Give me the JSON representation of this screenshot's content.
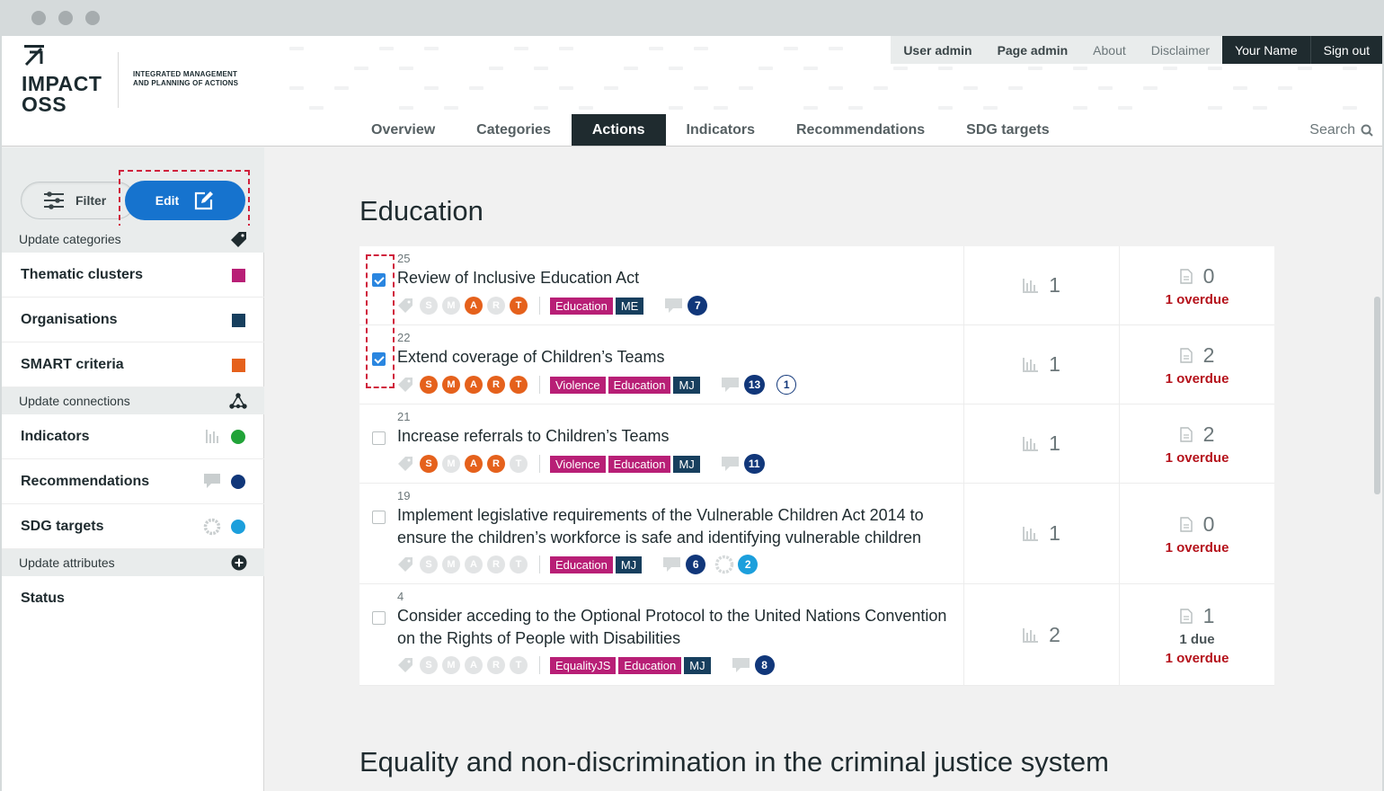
{
  "header": {
    "logo": {
      "line1": "IMPACT",
      "line2": "OSS"
    },
    "tagline_1": "INTEGRATED MANAGEMENT",
    "tagline_2": "AND PLANNING OF ACTIONS",
    "topbar": [
      "User admin",
      "Page admin",
      "About",
      "Disclaimer",
      "Your Name",
      "Sign out"
    ],
    "nav": [
      "Overview",
      "Categories",
      "Actions",
      "Indicators",
      "Recommendations",
      "SDG targets"
    ],
    "active_nav": "Actions",
    "search_label": "Search"
  },
  "sidebar": {
    "filter_label": "Filter",
    "edit_label": "Edit",
    "update_categories": "Update categories",
    "categories": [
      {
        "label": "Thematic clusters",
        "color": "#b81f76"
      },
      {
        "label": "Organisations",
        "color": "#173f5e"
      },
      {
        "label": "SMART criteria",
        "color": "#e5611c"
      }
    ],
    "update_connections": "Update connections",
    "connections": [
      {
        "label": "Indicators",
        "color": "#21a338",
        "icon": "bar-chart-icon"
      },
      {
        "label": "Recommendations",
        "color": "#11377a",
        "icon": "comment-icon"
      },
      {
        "label": "SDG targets",
        "color": "#1c9fdc",
        "icon": "sdg-ring-icon"
      }
    ],
    "update_attributes": "Update attributes",
    "attributes": [
      "Status"
    ]
  },
  "main": {
    "section_1_title": "Education",
    "section_2_title": "Equality and non-discrimination in the criminal justice system",
    "actions": [
      {
        "ref": "25",
        "title": "Review of Inclusive Education Act",
        "checked": true,
        "smart": [
          false,
          false,
          true,
          false,
          true
        ],
        "categories": [
          {
            "label": "Education",
            "color": "pink"
          },
          {
            "label": "ME",
            "color": "navy"
          }
        ],
        "recommendations": "7",
        "sdg": null,
        "extra": null,
        "indicators": "1",
        "reports": "0",
        "due": null,
        "overdue": "1 overdue"
      },
      {
        "ref": "22",
        "title": "Extend coverage of Children’s Teams",
        "checked": true,
        "smart": [
          true,
          true,
          true,
          true,
          true
        ],
        "categories": [
          {
            "label": "Violence",
            "color": "pink"
          },
          {
            "label": "Education",
            "color": "pink"
          },
          {
            "label": "MJ",
            "color": "navy"
          }
        ],
        "recommendations": "13",
        "sdg": null,
        "extra": "1",
        "indicators": "1",
        "reports": "2",
        "due": null,
        "overdue": "1 overdue"
      },
      {
        "ref": "21",
        "title": "Increase referrals to Children’s Teams",
        "checked": false,
        "smart": [
          true,
          false,
          true,
          true,
          false
        ],
        "categories": [
          {
            "label": "Violence",
            "color": "pink"
          },
          {
            "label": "Education",
            "color": "pink"
          },
          {
            "label": "MJ",
            "color": "navy"
          }
        ],
        "recommendations": "11",
        "sdg": null,
        "extra": null,
        "indicators": "1",
        "reports": "2",
        "due": null,
        "overdue": "1 overdue"
      },
      {
        "ref": "19",
        "title": "Implement legislative requirements of the Vulnerable Children Act 2014 to ensure the children’s workforce is safe and identifying vulnerable children",
        "checked": false,
        "smart": [
          false,
          false,
          false,
          false,
          false
        ],
        "categories": [
          {
            "label": "Education",
            "color": "pink"
          },
          {
            "label": "MJ",
            "color": "navy"
          }
        ],
        "recommendations": "6",
        "sdg": "2",
        "extra": null,
        "indicators": "1",
        "reports": "0",
        "due": null,
        "overdue": "1 overdue"
      },
      {
        "ref": "4",
        "title": "Consider acceding to the Optional Protocol to the United Nations Convention on the Rights of People with Disabilities",
        "checked": false,
        "smart": [
          false,
          false,
          false,
          false,
          false
        ],
        "categories": [
          {
            "label": "EqualityJS",
            "color": "pink"
          },
          {
            "label": "Education",
            "color": "pink"
          },
          {
            "label": "MJ",
            "color": "navy"
          }
        ],
        "recommendations": "8",
        "sdg": null,
        "extra": null,
        "indicators": "2",
        "reports": "1",
        "due": "1 due",
        "overdue": "1 overdue"
      }
    ],
    "smart_letters": [
      "S",
      "M",
      "A",
      "R",
      "T"
    ]
  }
}
